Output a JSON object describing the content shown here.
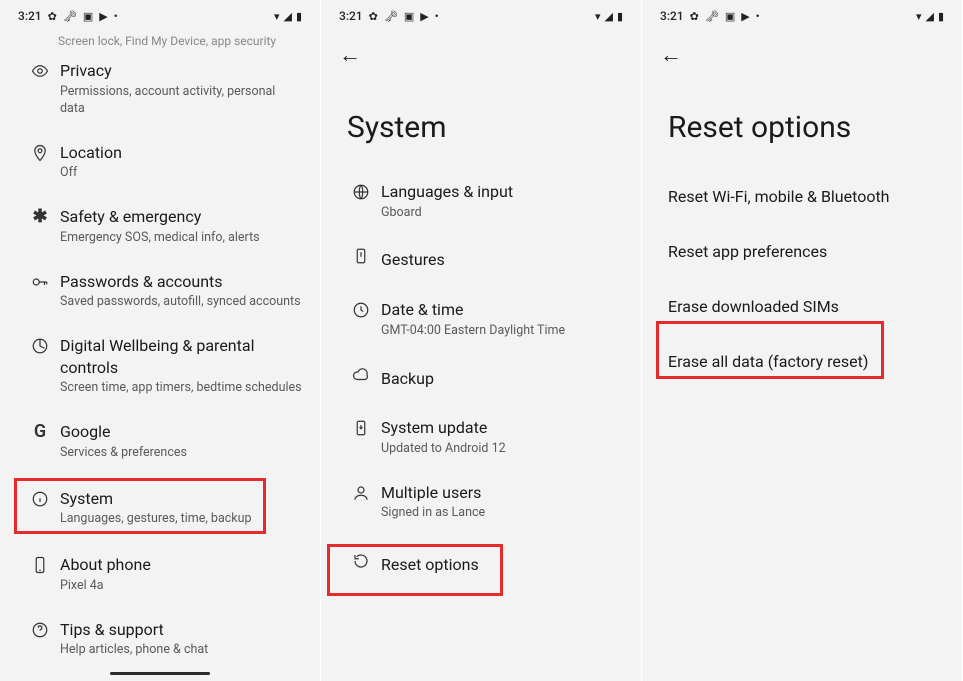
{
  "status": {
    "time": "3:21",
    "left_icons": [
      "✿",
      "🔑",
      "▣",
      "▶",
      "•"
    ],
    "right_icons": [
      "▾",
      "◢",
      "▮"
    ]
  },
  "screen1": {
    "cropped_subtitle": "Screen lock, Find My Device, app security",
    "items": [
      {
        "icon": "eye",
        "title": "Privacy",
        "subtitle": "Permissions, account activity, personal data"
      },
      {
        "icon": "pin",
        "title": "Location",
        "subtitle": "Off"
      },
      {
        "icon": "asterisk",
        "title": "Safety & emergency",
        "subtitle": "Emergency SOS, medical info, alerts"
      },
      {
        "icon": "key",
        "title": "Passwords & accounts",
        "subtitle": "Saved passwords, autofill, synced accounts"
      },
      {
        "icon": "wellbeing",
        "title": "Digital Wellbeing & parental controls",
        "subtitle": "Screen time, app timers, bedtime schedules"
      },
      {
        "icon": "google",
        "title": "Google",
        "subtitle": "Services & preferences"
      },
      {
        "icon": "info",
        "title": "System",
        "subtitle": "Languages, gestures, time, backup"
      },
      {
        "icon": "phone",
        "title": "About phone",
        "subtitle": "Pixel 4a"
      },
      {
        "icon": "help",
        "title": "Tips & support",
        "subtitle": "Help articles, phone & chat"
      }
    ]
  },
  "screen2": {
    "title": "System",
    "items": [
      {
        "icon": "globe",
        "title": "Languages & input",
        "subtitle": "Gboard"
      },
      {
        "icon": "gesture",
        "title": "Gestures",
        "subtitle": ""
      },
      {
        "icon": "clock",
        "title": "Date & time",
        "subtitle": "GMT-04:00 Eastern Daylight Time"
      },
      {
        "icon": "cloud",
        "title": "Backup",
        "subtitle": ""
      },
      {
        "icon": "update",
        "title": "System update",
        "subtitle": "Updated to Android 12"
      },
      {
        "icon": "users",
        "title": "Multiple users",
        "subtitle": "Signed in as Lance"
      },
      {
        "icon": "reset",
        "title": "Reset options",
        "subtitle": ""
      }
    ]
  },
  "screen3": {
    "title": "Reset options",
    "items": [
      "Reset Wi-Fi, mobile & Bluetooth",
      "Reset app preferences",
      "Erase downloaded SIMs",
      "Erase all data (factory reset)"
    ]
  }
}
